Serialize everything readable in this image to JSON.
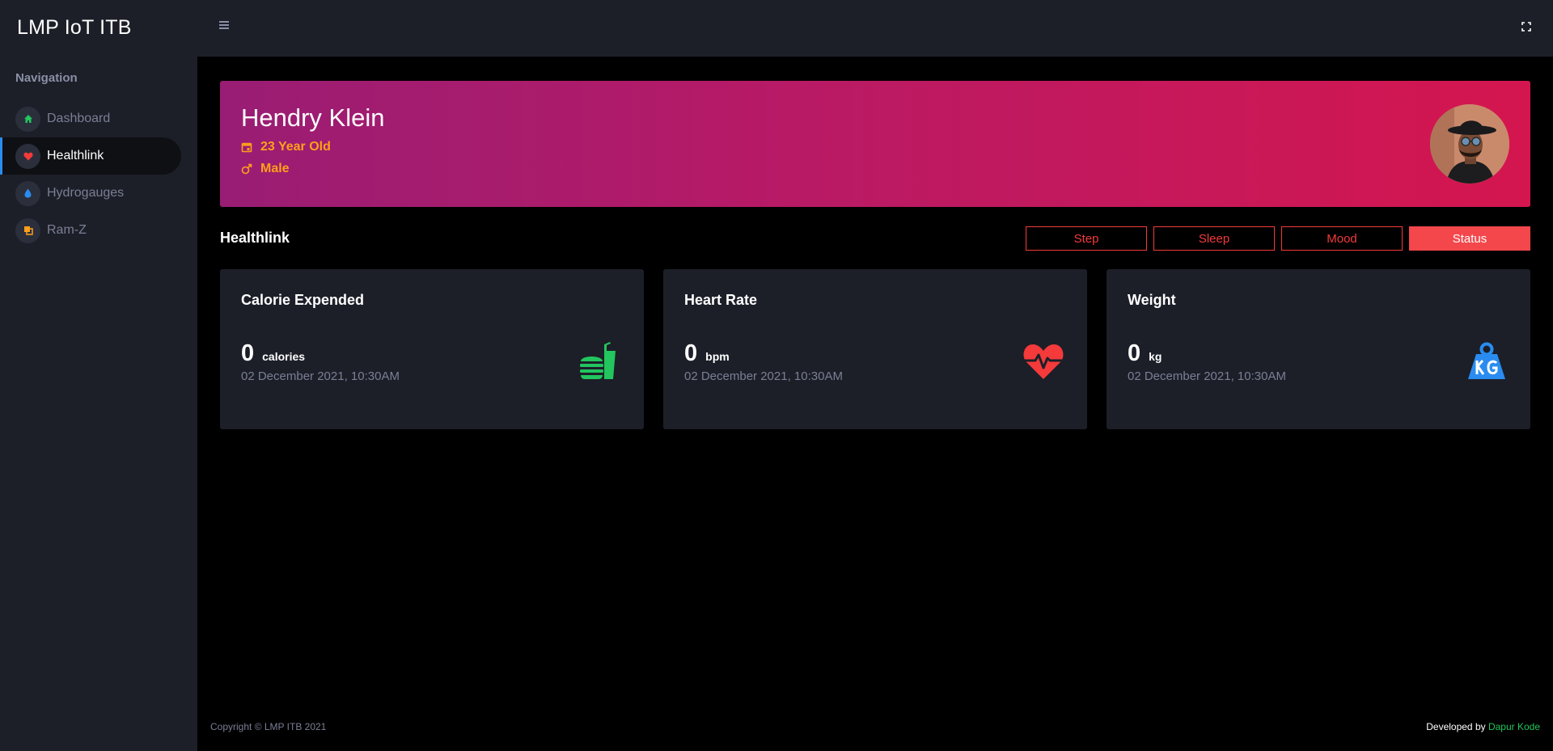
{
  "app": {
    "brand": "LMP IoT ITB"
  },
  "colors": {
    "accent_red": "#f43a3a",
    "orange": "#ff9f1a",
    "green": "#22c55e",
    "blue": "#2a8cf0"
  },
  "sidebar": {
    "heading": "Navigation",
    "items": [
      {
        "label": "Dashboard",
        "icon": "home-icon",
        "active": false
      },
      {
        "label": "Healthlink",
        "icon": "heart-icon",
        "active": true
      },
      {
        "label": "Hydrogauges",
        "icon": "water-drop-icon",
        "active": false
      },
      {
        "label": "Ram-Z",
        "icon": "layers-icon",
        "active": false
      }
    ]
  },
  "profile": {
    "name": "Hendry Klein",
    "age": "23 Year Old",
    "gender": "Male"
  },
  "section": {
    "title": "Healthlink",
    "tabs": [
      {
        "label": "Step",
        "active": false
      },
      {
        "label": "Sleep",
        "active": false
      },
      {
        "label": "Mood",
        "active": false
      },
      {
        "label": "Status",
        "active": true
      }
    ]
  },
  "cards": [
    {
      "title": "Calorie Expended",
      "value": "0",
      "unit": "calories",
      "date": "02 December 2021, 10:30AM",
      "icon": "fastfood-icon"
    },
    {
      "title": "Heart Rate",
      "value": "0",
      "unit": "bpm",
      "date": "02 December 2021, 10:30AM",
      "icon": "heart-pulse-icon"
    },
    {
      "title": "Weight",
      "value": "0",
      "unit": "kg",
      "date": "02 December 2021, 10:30AM",
      "icon": "weight-kg-icon"
    }
  ],
  "footer": {
    "copyright": "Copyright © LMP ITB 2021",
    "developed_prefix": "Developed by ",
    "developer": "Dapur Kode"
  }
}
